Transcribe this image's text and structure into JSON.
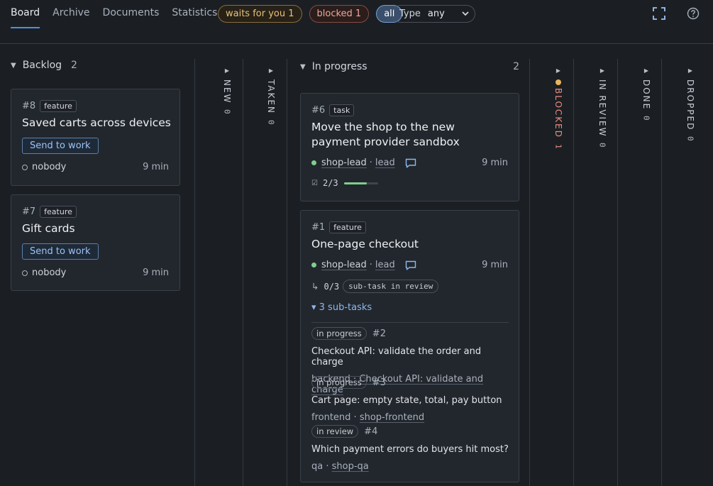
{
  "nav": {
    "tabs": [
      "Board",
      "Archive",
      "Documents",
      "Statistics"
    ],
    "active_tab": "Board"
  },
  "filters": {
    "waits": "waits for you 1",
    "blocked": "blocked 1",
    "all": "all",
    "type_label": "Type",
    "type_value": "any"
  },
  "columns": {
    "backlog": {
      "label": "Backlog",
      "count": "2"
    },
    "new": {
      "label": "NEW",
      "count": "0"
    },
    "taken": {
      "label": "TAKEN",
      "count": "0"
    },
    "in_progress": {
      "label": "In progress",
      "count": "2"
    },
    "blocked": {
      "label": "BLOCKED",
      "count": "1"
    },
    "in_review": {
      "label": "IN REVIEW",
      "count": "0"
    },
    "done": {
      "label": "DONE",
      "count": "0"
    },
    "dropped": {
      "label": "DROPPED",
      "count": "0"
    }
  },
  "backlog_cards": [
    {
      "id": "#8",
      "tag": "feature",
      "title": "Saved carts across devices",
      "button": "Send to work",
      "assignee": "nobody",
      "time": "9 min"
    },
    {
      "id": "#7",
      "tag": "feature",
      "title": "Gift cards",
      "button": "Send to work",
      "assignee": "nobody",
      "time": "9 min"
    }
  ],
  "progress_cards": [
    {
      "id": "#6",
      "tag": "task",
      "title": "Move the shop to the new payment provider sandbox",
      "team": "shop-lead",
      "sep": "·",
      "role": "lead",
      "time": "9 min",
      "check": "☑",
      "progress_text": "2/3",
      "progress_value": 0.6667
    },
    {
      "id": "#1",
      "tag": "feature",
      "title": "One-page checkout",
      "team": "shop-lead",
      "sep": "·",
      "role": "lead",
      "time": "9 min",
      "sub_arrow": "↳",
      "sub_progress": "0/3",
      "sub_badge": "sub-task in review",
      "subtasks_toggle": "▾ 3 sub-tasks",
      "subtasks": [
        {
          "status": "in progress",
          "num": "#2",
          "title": "Checkout API: validate the order and charge",
          "team": "backend",
          "link": "Checkout API: validate and charge"
        },
        {
          "status": "in progress",
          "num": "#3",
          "title": "Cart page: empty state, total, pay button",
          "team": "frontend",
          "link": "shop-frontend"
        },
        {
          "status": "in review",
          "num": "#4",
          "title": "Which payment errors do buyers hit most?",
          "team": "qa",
          "link": "shop-qa"
        }
      ]
    }
  ],
  "colors": {
    "accent": "#4d8fe0",
    "ok": "#7fcf8a",
    "blocked": "#e98e80",
    "warn": "#e7b65b"
  },
  "icons": {
    "fullscreen": "fullscreen-icon",
    "help": "help-icon",
    "comment": "comment-icon"
  }
}
